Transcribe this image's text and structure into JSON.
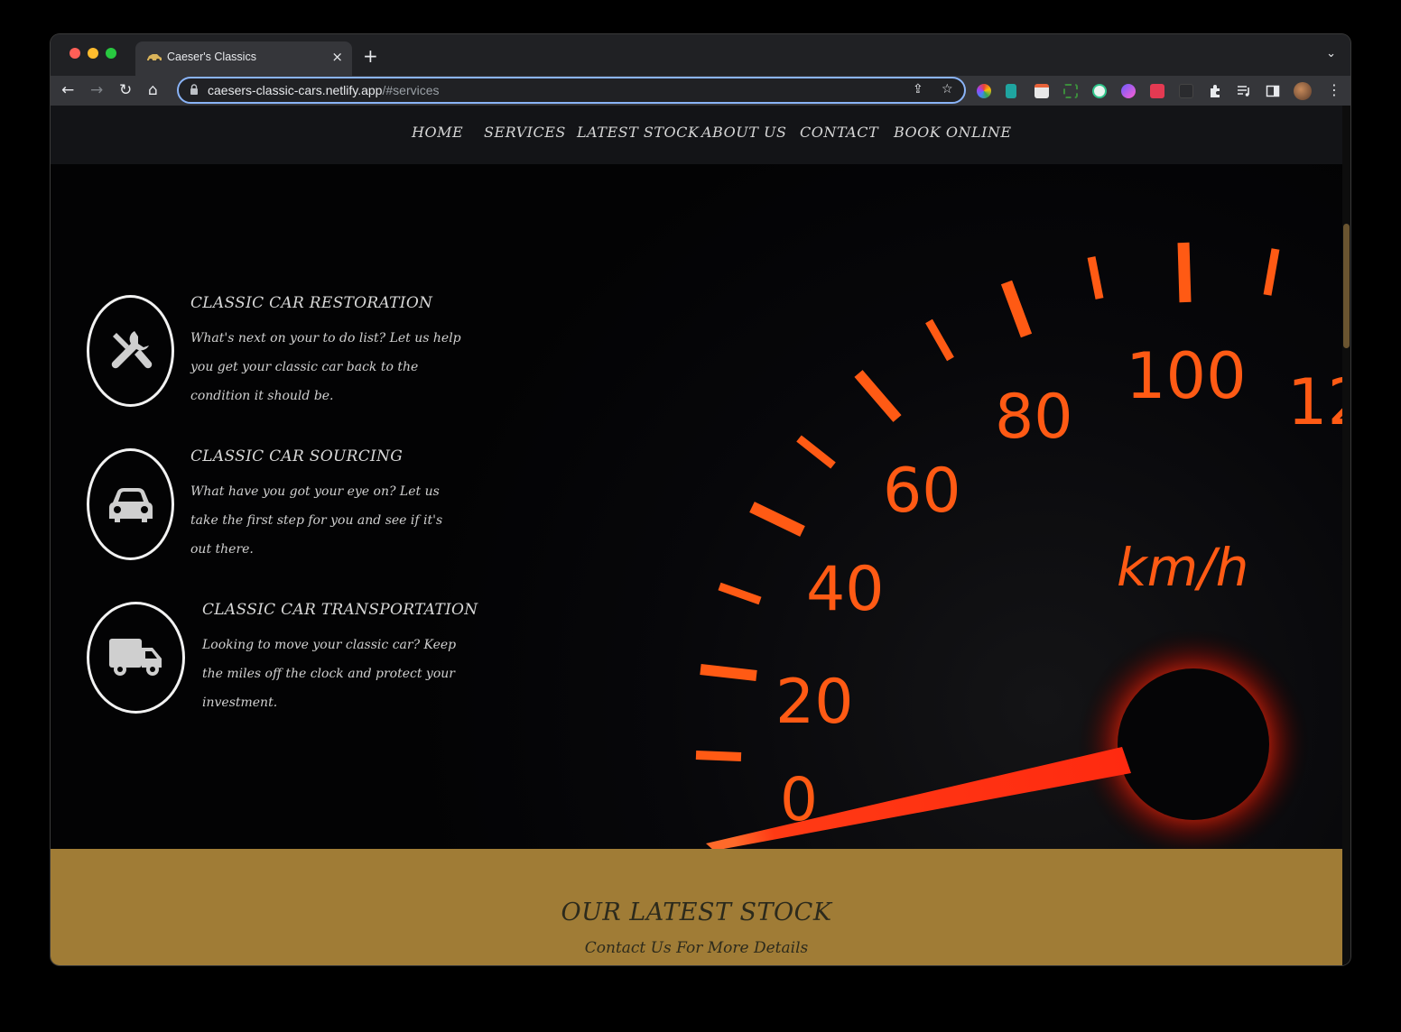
{
  "browser": {
    "tab_title": "Caeser's Classics",
    "tab_close": "×",
    "new_tab": "+",
    "tab_menu": "⌄",
    "url_host": "caesers-classic-cars.netlify.app",
    "url_path": "/#services",
    "nav": {
      "back": "←",
      "forward": "→",
      "reload": "↻",
      "home": "⌂"
    },
    "omnibox_icons": {
      "share": "⇪",
      "bookmark": "☆"
    },
    "menu": "⋮"
  },
  "site_nav": {
    "items": [
      {
        "label": "HOME"
      },
      {
        "label": "SERVICES"
      },
      {
        "label": "LATEST STOCK"
      },
      {
        "label": "ABOUT US"
      },
      {
        "label": "CONTACT"
      },
      {
        "label": "BOOK ONLINE"
      }
    ]
  },
  "services": [
    {
      "icon": "tools-icon",
      "title": "CLASSIC CAR RESTORATION",
      "lines": [
        "What's next on your to do list? Let us help",
        "you get your classic car back to the",
        "condition it should be."
      ]
    },
    {
      "icon": "car-icon",
      "title": "CLASSIC CAR SOURCING",
      "lines": [
        "What have you got your eye on? Let us",
        "take the first step for you and see if it's",
        "out there."
      ]
    },
    {
      "icon": "truck-icon",
      "title": "CLASSIC CAR TRANSPORTATION",
      "lines": [
        "Looking to move your classic car? Keep",
        "the miles off the clock and protect your",
        "investment."
      ]
    }
  ],
  "speedometer": {
    "labels": [
      "0",
      "20",
      "40",
      "60",
      "80",
      "100",
      "12"
    ],
    "unit": "km/h",
    "color": "#ff5a14"
  },
  "latest_stock": {
    "title": "OUR LATEST STOCK",
    "subtitle": "Contact Us For More Details",
    "background": "#a07c36"
  }
}
